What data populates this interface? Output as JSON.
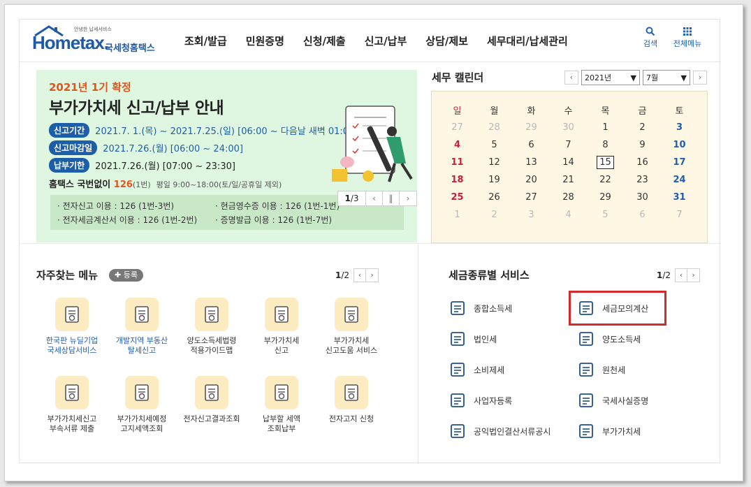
{
  "header": {
    "logo_text": "Hometax.",
    "logo_tiny": "안녕한 납세서비스",
    "logo_korean": "국세청홈택스",
    "nav": [
      "조회/발급",
      "민원증명",
      "신청/제출",
      "신고/납부",
      "상담/제보",
      "세무대리/납세관리"
    ],
    "search_label": "검색",
    "menu_label": "전체메뉴"
  },
  "banner": {
    "kicker": "2021년 1기 확정",
    "headline": "부가가치세 신고/납부 안내",
    "rows": [
      {
        "pill": "신고기간",
        "text": "2021.7. 1.(목) ~ 2021.7.25.(일) [06:00 ~ 다음날 새벽 01:00]"
      },
      {
        "pill": "신고마감일",
        "text": "2021.7.26.(월) [06:00 ~ 24:00]"
      },
      {
        "pill": "납부기한",
        "text": "2021.7.26.(월) [07:00 ~ 23:30]"
      }
    ],
    "call_prefix": "홈택스 국번없이 ",
    "call_number": "126",
    "call_suffix": "(1번)",
    "call_hours": "평일 9:00~18:00(토/일/공휴일 제외)",
    "info": [
      "· 전자신고 이용 : 126 (1번-3번)",
      "· 현금영수증 이용 : 126 (1번-1번)",
      "· 전자세금계산서 이용 : 126 (1번-2번)",
      "· 증명발급 이용 : 126 (1번-7번)"
    ],
    "pager_current": "1",
    "pager_total": "/3"
  },
  "calendar": {
    "title": "세무 캘린더",
    "year": "2021년",
    "month": "7월",
    "weekdays": [
      "일",
      "월",
      "화",
      "수",
      "목",
      "금",
      "토"
    ],
    "weeks": [
      [
        "27",
        "28",
        "29",
        "30",
        "1",
        "2",
        "3"
      ],
      [
        "4",
        "5",
        "6",
        "7",
        "8",
        "9",
        "10"
      ],
      [
        "11",
        "12",
        "13",
        "14",
        "15",
        "16",
        "17"
      ],
      [
        "18",
        "19",
        "20",
        "21",
        "22",
        "23",
        "24"
      ],
      [
        "25",
        "26",
        "27",
        "28",
        "29",
        "30",
        "31"
      ],
      [
        "1",
        "2",
        "3",
        "4",
        "5",
        "6",
        "7"
      ]
    ],
    "today": "15"
  },
  "favorites": {
    "title": "자주찾는 메뉴",
    "register_label": "등록",
    "page_current": "1",
    "page_total": "/2",
    "items": [
      {
        "label": "한국판 뉴딜기업\n국세상담서비스"
      },
      {
        "label": "개발지역 부동산\n탈세신고"
      },
      {
        "label": "양도소득세법령\n적용가이드맵"
      },
      {
        "label": "부가가치세\n신고"
      },
      {
        "label": "부가가치세\n신고도움 서비스"
      },
      {
        "label": "부가가치세신고\n부속서류 제출"
      },
      {
        "label": "부가가치세예정\n고지세액조회"
      },
      {
        "label": "전자신고결과조회"
      },
      {
        "label": "납부할 세액\n조회납부"
      },
      {
        "label": "전자고지 신청"
      }
    ]
  },
  "tax_services": {
    "title": "세금종류별 서비스",
    "page_current": "1",
    "page_total": "/2",
    "items": [
      {
        "label": "종합소득세",
        "icon": "money-bag-icon"
      },
      {
        "label": "세금모의계산",
        "icon": "calculator-icon"
      },
      {
        "label": "법인세",
        "icon": "building-icon"
      },
      {
        "label": "양도소득세",
        "icon": "document-pen-icon"
      },
      {
        "label": "소비제세",
        "icon": "diamond-icon"
      },
      {
        "label": "원천세",
        "icon": "receipt-icon"
      },
      {
        "label": "사업자등록",
        "icon": "person-icon"
      },
      {
        "label": "국세사실증명",
        "icon": "certificate-icon"
      },
      {
        "label": "공익법인결산서류공시",
        "icon": "clipboard-icon"
      },
      {
        "label": "부가가치세",
        "icon": "vat-icon"
      }
    ]
  },
  "colors": {
    "brand": "#1f5aa6",
    "accent_orange": "#e2541b",
    "banner_bg": "#dff6e0",
    "calendar_bg": "#fdf7e4",
    "highlight": "#d42a2a"
  }
}
